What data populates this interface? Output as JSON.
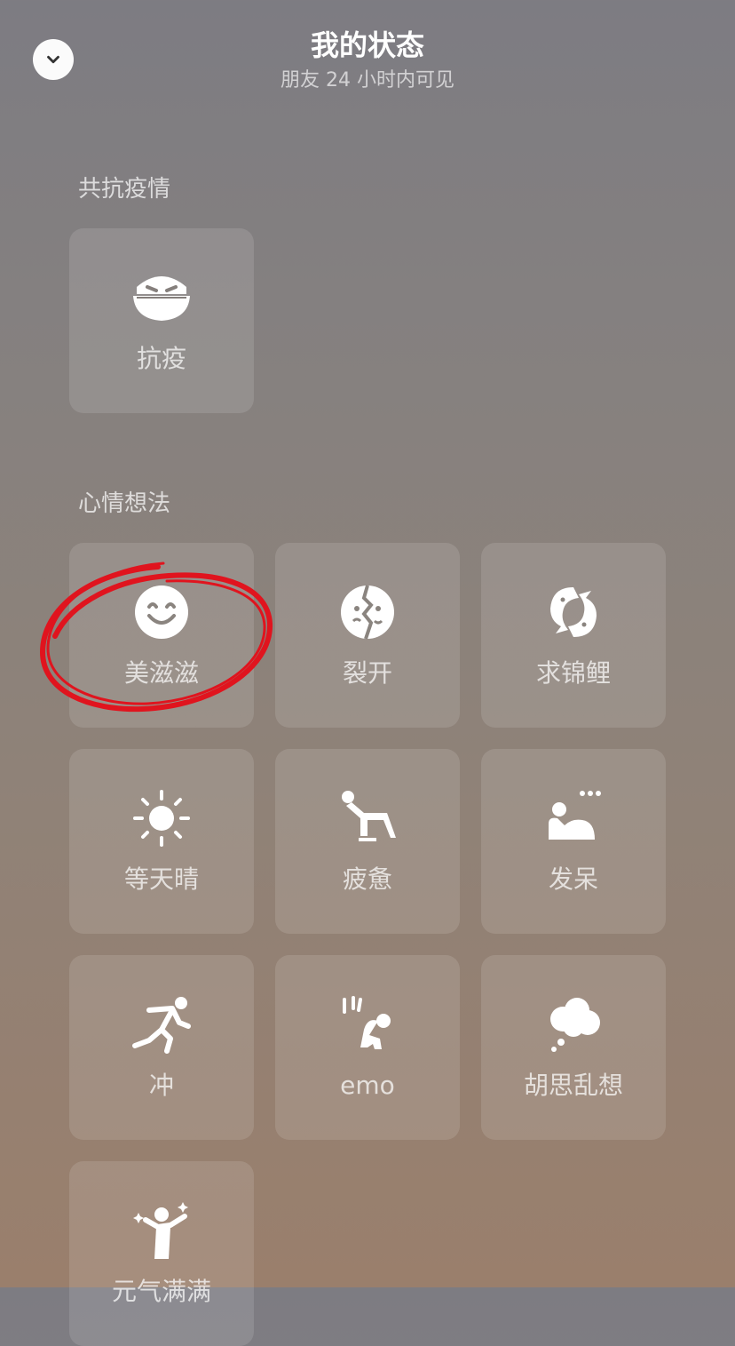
{
  "header": {
    "title": "我的状态",
    "subtitle": "朋友 24 小时内可见"
  },
  "sections": [
    {
      "title": "共抗疫情",
      "items": [
        {
          "label": "抗疫",
          "icon": "mask-face-icon"
        }
      ]
    },
    {
      "title": "心情想法",
      "items": [
        {
          "label": "美滋滋",
          "icon": "smile-face-icon"
        },
        {
          "label": "裂开",
          "icon": "cracked-face-icon"
        },
        {
          "label": "求锦鲤",
          "icon": "koi-fish-icon"
        },
        {
          "label": "等天晴",
          "icon": "sun-icon"
        },
        {
          "label": "疲惫",
          "icon": "tired-person-icon"
        },
        {
          "label": "发呆",
          "icon": "dazed-person-icon"
        },
        {
          "label": "冲",
          "icon": "running-person-icon"
        },
        {
          "label": "emo",
          "icon": "sad-person-icon"
        },
        {
          "label": "胡思乱想",
          "icon": "thought-cloud-icon"
        },
        {
          "label": "元气满满",
          "icon": "energetic-person-icon"
        }
      ]
    }
  ],
  "colors": {
    "annotation": "#e0141e",
    "icon": "#ffffff",
    "close_button": "#fbfbfb"
  }
}
